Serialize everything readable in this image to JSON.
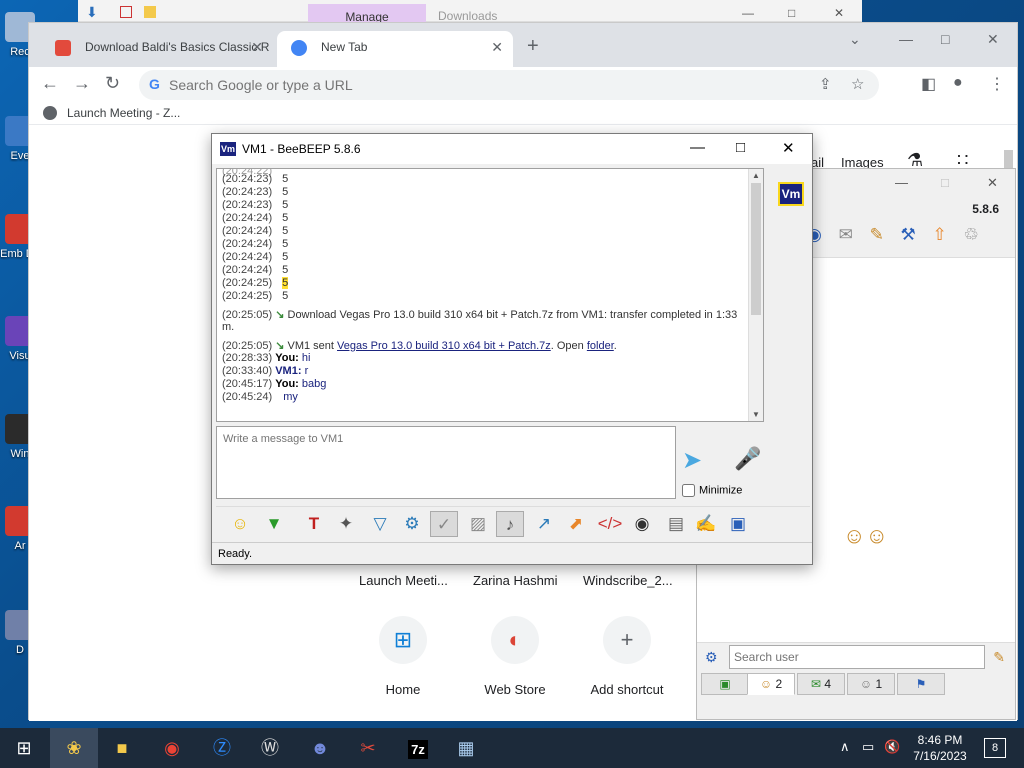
{
  "desktop": {
    "icons": [
      {
        "label": "Rec",
        "color": "#9fb8d6"
      },
      {
        "label": "Eve",
        "color": "#3b79c5"
      },
      {
        "label": "Emb De",
        "color": "#d23a2f"
      },
      {
        "label": "Visu",
        "color": "#6a44b8"
      },
      {
        "label": "Win",
        "color": "#2b2b2b"
      },
      {
        "label": "Ar",
        "color": "#d23a2f"
      },
      {
        "label": "D",
        "color": "#7080a8"
      }
    ]
  },
  "explorer_strip": {
    "manage": "Manage",
    "downloads": "Downloads"
  },
  "chrome": {
    "tabs": [
      {
        "title": "Download Baldi's Basics Classic R",
        "favicon_color": "#e24a3c",
        "active": false
      },
      {
        "title": "New Tab",
        "favicon_color": "#4285f4",
        "active": true
      }
    ],
    "omnibox_placeholder": "Search Google or type a URL",
    "bookmark": "Launch Meeting - Z...",
    "links": {
      "gmail": "ail",
      "images": "Images"
    },
    "shortcuts_row": [
      "Launch Meeti...",
      "Zarina Hashmi",
      "Windscribe_2..."
    ],
    "tiles": [
      {
        "label": "Home",
        "glyph": "⊞"
      },
      {
        "label": "Web Store",
        "glyph": "◐"
      },
      {
        "label": "Add shortcut",
        "glyph": "+"
      }
    ]
  },
  "beebeep_secondary": {
    "version": "5.8.6",
    "search_placeholder": "Search user",
    "tabs": [
      {
        "label": "",
        "selected": false
      },
      {
        "label": "2",
        "selected": true
      },
      {
        "label": "4",
        "selected": false
      },
      {
        "label": "1",
        "selected": false
      },
      {
        "label": "",
        "selected": false
      }
    ]
  },
  "beebeep": {
    "title": "VM1 - BeeBEEP 5.8.6",
    "logo": "Vm",
    "badge": "Vm",
    "messages": [
      {
        "ts": "(20:24:23)",
        "text": "5"
      },
      {
        "ts": "(20:24:23)",
        "text": "5"
      },
      {
        "ts": "(20:24:23)",
        "text": "5"
      },
      {
        "ts": "(20:24:24)",
        "text": "5"
      },
      {
        "ts": "(20:24:24)",
        "text": "5"
      },
      {
        "ts": "(20:24:24)",
        "text": "5"
      },
      {
        "ts": "(20:24:24)",
        "text": "5"
      },
      {
        "ts": "(20:24:24)",
        "text": "5"
      },
      {
        "ts": "(20:24:25)",
        "text": "5",
        "highlight": true
      },
      {
        "ts": "(20:24:25)",
        "text": "5"
      }
    ],
    "transfer": {
      "ts": "(20:25:05)",
      "text_line1": "Download Vegas Pro 13.0 build 310 x64 bit + Patch.7z from VM1: transfer completed in 1:33",
      "text_line2": "m."
    },
    "sent": {
      "ts": "(20:25:05)",
      "prefix": "VM1 sent",
      "file": "Vegas Pro 13.0 build 310 x64 bit + Patch.7z",
      "mid": ". Open",
      "folder": "folder",
      "end": "."
    },
    "chat": [
      {
        "ts": "(20:28:33)",
        "who": "You:",
        "text": "hi"
      },
      {
        "ts": "(20:33:40)",
        "who": "VM1:",
        "text": "r"
      },
      {
        "ts": "(20:45:17)",
        "who": "You:",
        "text": "babg"
      },
      {
        "ts": "(20:45:24)",
        "who": "",
        "text": "my"
      }
    ],
    "compose_placeholder": "Write a message to VM1",
    "minimize_label": "Minimize",
    "status": "Ready."
  },
  "taskbar": {
    "apps": [
      "beebeep",
      "file-explorer",
      "chrome",
      "zoom",
      "winrar",
      "discord",
      "app",
      "7zip",
      "network"
    ],
    "clock_time": "8:46 PM",
    "clock_date": "7/16/2023",
    "notifications": "8"
  }
}
